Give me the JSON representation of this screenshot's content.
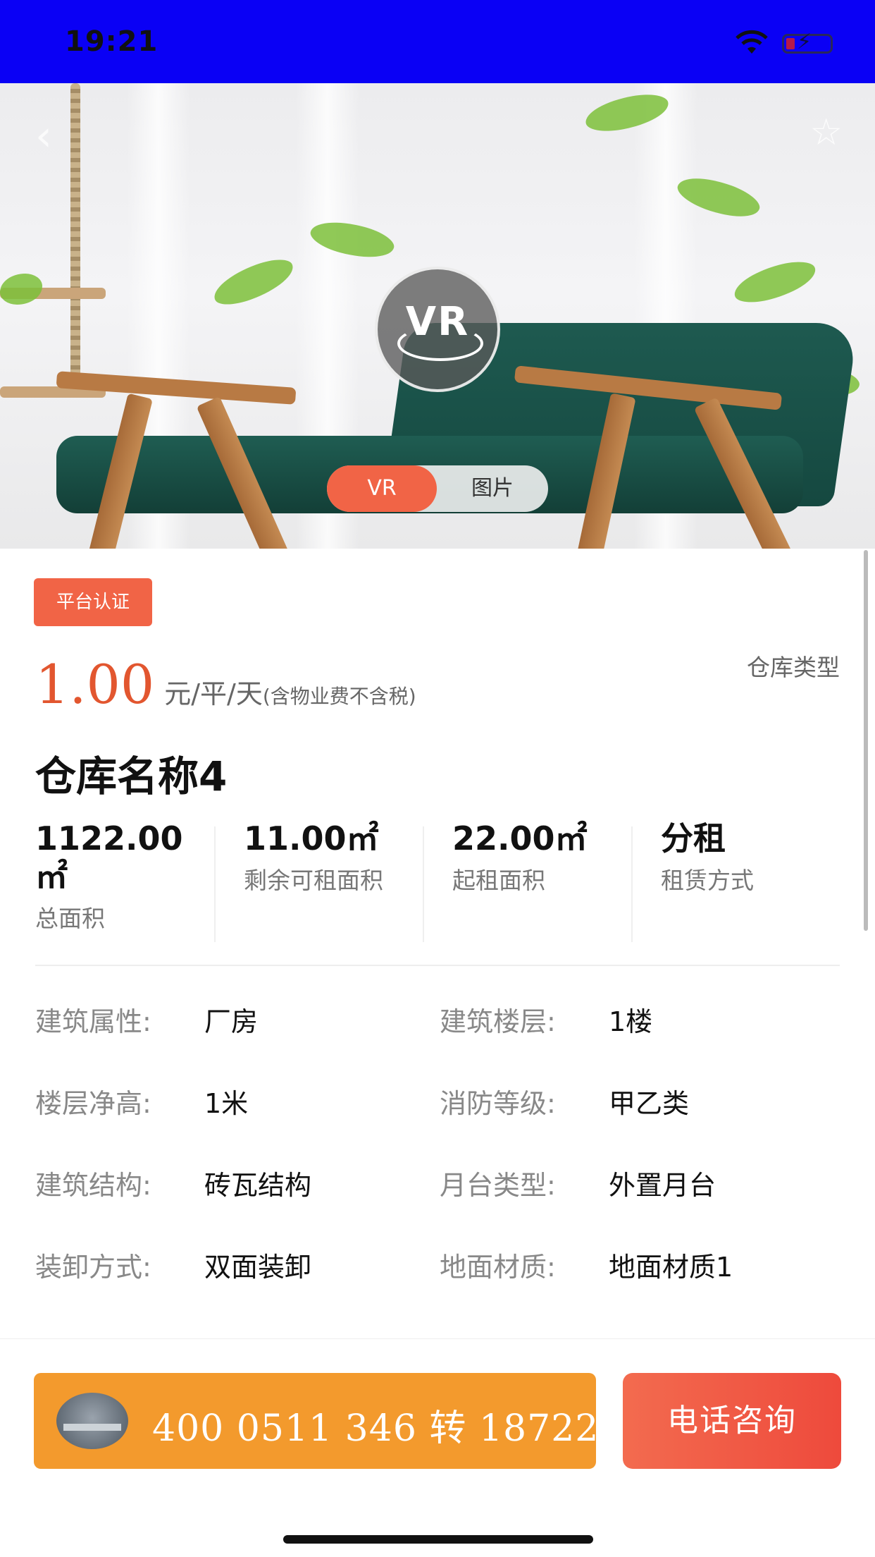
{
  "status_bar": {
    "time": "19:21",
    "background": "#0a00f5"
  },
  "hero": {
    "vr_badge": "VR",
    "toggle": {
      "vr_label": "VR",
      "pictures_label": "图片",
      "active": "VR"
    },
    "icons": [
      "back-icon",
      "star-icon"
    ]
  },
  "listing": {
    "badge": "平台认证",
    "price": "1.00",
    "price_unit": "元/平/天",
    "price_note": "(含物业费不含税)",
    "type_label": "仓库类型",
    "title": "仓库名称4",
    "stats": [
      {
        "value": "1122.00㎡",
        "label": "总面积"
      },
      {
        "value": "11.00㎡",
        "label": "剩余可租面积"
      },
      {
        "value": "22.00㎡",
        "label": "起租面积"
      },
      {
        "value": "分租",
        "label": "租赁方式"
      }
    ],
    "properties": [
      {
        "label": "建筑属性:",
        "value": "厂房"
      },
      {
        "label": "建筑楼层:",
        "value": "1楼"
      },
      {
        "label": "楼层净高:",
        "value": "1米"
      },
      {
        "label": "消防等级:",
        "value": "甲乙类"
      },
      {
        "label": "建筑结构:",
        "value": "砖瓦结构"
      },
      {
        "label": "月台类型:",
        "value": "外置月台"
      },
      {
        "label": "装卸方式:",
        "value": "双面装卸"
      },
      {
        "label": "地面材质:",
        "value": "地面材质1"
      }
    ]
  },
  "bottom_bar": {
    "phone": "400 0511 346 转 18722",
    "consult_label": "电话咨询",
    "colors": {
      "phone_bar": "#f39a2d",
      "consult": "#ee4a3c",
      "accent": "#f16446"
    }
  }
}
